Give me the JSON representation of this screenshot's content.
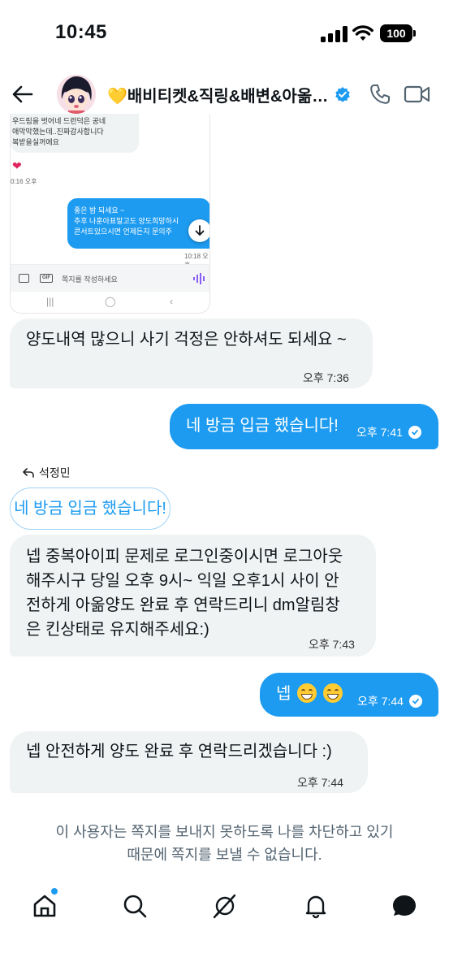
{
  "status_bar": {
    "time": "10:45",
    "battery": "100"
  },
  "header": {
    "title": "💛배비티켓&직링&배변&아옮양도",
    "back_icon": "arrow-left-icon",
    "call_icon": "phone-icon",
    "video_icon": "video-camera-icon"
  },
  "embedded_screenshot": {
    "prev_message_lines": [
      "우드림을 벗어네 드런덕은 공네",
      "애막막했는데..진짜감사합니다",
      "복받을실꺼에요"
    ],
    "heart": "❤",
    "time_1": "0:16 오후",
    "sent_lines": [
      "좋은 밤 되세요 ~",
      "추후 나훈아표말고도 양도희망하시",
      "콘서트있으시면 언제든지 문의주"
    ],
    "time_2": "10:18 오후",
    "input_placeholder": "쪽지를 작성하세요",
    "gif_label": "GIF"
  },
  "messages": {
    "m1": {
      "text": "양도내역 많으니 사기 걱정은 안하셔도 되세요 ~",
      "time": "오후 7:36"
    },
    "m2": {
      "text": "네 방금 입금 했습니다!",
      "time": "오후 7:41"
    },
    "reply": {
      "label": "석정민",
      "quote": "네 방금 입금 했습니다!"
    },
    "m3": {
      "lines": [
        "넵 중복아이피 문제로 로그인중이시면 로그아웃",
        "해주시구 당일 오후 9시~ 익일 오후1시 사이 안",
        "전하게 아옮양도 완료 후 연락드리니 dm알림창",
        "은 킨상태로 유지해주세요:)"
      ],
      "time": "오후 7:43"
    },
    "m4": {
      "text": "넵",
      "time": "오후 7:44"
    },
    "m5": {
      "text": "넵 안전하게 양도 완료 후 연락드리겠습니다 :)",
      "time": "오후 7:44"
    }
  },
  "blocked_notice": {
    "line1": "이 사용자는 쪽지를 보내지 못하도록 나를 차단하고 있기",
    "line2": "때문에 쪽지를 보낼 수 없습니다."
  },
  "bottom_nav": [
    "home-icon",
    "search-icon",
    "grok-icon",
    "bell-icon",
    "messages-icon"
  ],
  "colors": {
    "accent": "#1d9bf0",
    "incoming_bubble": "#eff3f4",
    "text": "#0f1419",
    "muted": "#536471"
  }
}
